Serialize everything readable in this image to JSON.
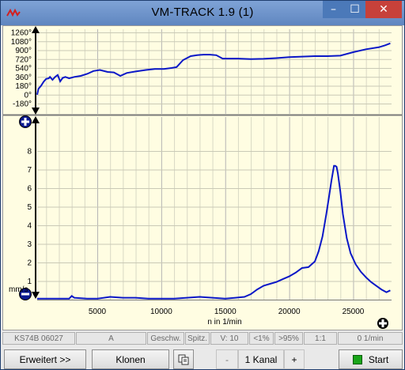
{
  "window": {
    "title": "VM-TRACK 1.9 (1)",
    "minimize_glyph": "–",
    "maximize_glyph": "☐",
    "close_glyph": "✕"
  },
  "top_plot": {
    "yticks": [
      "1260°",
      "1080°",
      "900°",
      "720°",
      "540°",
      "360°",
      "180°",
      "0°",
      "-180°"
    ],
    "color": "#0a17c7"
  },
  "bottom_plot": {
    "ylabel": "mms",
    "unit_label": "mm/s",
    "yticks": [
      "8",
      "7",
      "6",
      "5",
      "4",
      "3",
      "2",
      "1"
    ],
    "xticks": [
      "5000",
      "10000",
      "15000",
      "20000",
      "25000"
    ],
    "xlabel": "n in 1/min",
    "color": "#0a17c7"
  },
  "chart_data": [
    {
      "type": "line",
      "title": "",
      "xlabel": "",
      "ylabel": "",
      "xlim": [
        300,
        28000
      ],
      "ylim": [
        -270,
        1350
      ],
      "yticks": [
        1260,
        1080,
        900,
        720,
        540,
        360,
        180,
        0,
        -180
      ],
      "grid": true,
      "series": [
        {
          "x": [
            300,
            400,
            600,
            800,
            1000,
            1200,
            1300,
            1500,
            1700,
            1900,
            2100,
            2300,
            2500,
            2800,
            3200,
            3700,
            4200,
            4700,
            5200,
            5800,
            6300,
            6800,
            7300,
            8000,
            8800,
            9500,
            10200,
            10800,
            11200,
            11700,
            12300,
            12800,
            13300,
            13800,
            14300,
            14800,
            15300,
            16000,
            17000,
            18000,
            19000,
            20000,
            21000,
            22000,
            23000,
            24000,
            25000,
            26000,
            27000,
            27500,
            27900
          ],
          "y": [
            0,
            120,
            180,
            260,
            320,
            330,
            360,
            300,
            360,
            400,
            270,
            340,
            360,
            330,
            360,
            380,
            420,
            480,
            500,
            460,
            450,
            380,
            440,
            470,
            500,
            520,
            520,
            540,
            560,
            700,
            780,
            800,
            810,
            810,
            800,
            730,
            730,
            730,
            720,
            725,
            740,
            760,
            770,
            780,
            780,
            790,
            860,
            920,
            960,
            1000,
            1040
          ]
        }
      ]
    },
    {
      "type": "line",
      "title": "",
      "xlabel": "n in 1/min",
      "ylabel": "mm/s",
      "xlim": [
        300,
        28000
      ],
      "ylim": [
        0,
        9
      ],
      "xticks": [
        5000,
        10000,
        15000,
        20000,
        25000
      ],
      "yticks": [
        1,
        2,
        3,
        4,
        5,
        6,
        7,
        8
      ],
      "grid": true,
      "series": [
        {
          "x": [
            300,
            1500,
            2800,
            3000,
            3200,
            4200,
            5000,
            6000,
            7000,
            8000,
            9000,
            10000,
            11000,
            12000,
            13000,
            14000,
            15000,
            15800,
            16500,
            17000,
            17500,
            18000,
            18500,
            19000,
            19500,
            20000,
            20500,
            21000,
            21500,
            22000,
            22300,
            22600,
            22900,
            23100,
            23300,
            23500,
            23600,
            23700,
            23800,
            24000,
            24200,
            24500,
            24800,
            25200,
            25600,
            26000,
            26400,
            26800,
            27200,
            27600,
            27900
          ],
          "y": [
            0.05,
            0.05,
            0.05,
            0.2,
            0.1,
            0.05,
            0.05,
            0.15,
            0.1,
            0.1,
            0.05,
            0.05,
            0.05,
            0.1,
            0.15,
            0.1,
            0.05,
            0.1,
            0.15,
            0.3,
            0.55,
            0.75,
            0.85,
            0.95,
            1.1,
            1.25,
            1.45,
            1.7,
            1.75,
            2.05,
            2.6,
            3.4,
            4.6,
            5.5,
            6.4,
            7.2,
            7.2,
            7.15,
            6.8,
            5.8,
            4.6,
            3.3,
            2.5,
            1.9,
            1.5,
            1.2,
            0.95,
            0.75,
            0.55,
            0.4,
            0.5
          ]
        }
      ]
    }
  ],
  "status": {
    "device": "KS74B 06027",
    "channel": "A",
    "speed": "Geschw.",
    "peak": "Spitz.",
    "v": "V: 10",
    "lt": "<1%",
    "gt": ">95%",
    "ratio": "1:1",
    "rpm": "0 1/min"
  },
  "buttons": {
    "erweitert": "Erweitert >>",
    "klonen": "Klonen",
    "copy_icon": "copy-icon",
    "minus": "-",
    "kanal": "1 Kanal",
    "plus": "+",
    "start": "Start"
  },
  "colors": {
    "plot_background": "#fffde2",
    "trace": "#0a17c7",
    "title_bar": "#6b90c8",
    "close": "#c7413a",
    "start_led": "#1aa51a"
  }
}
